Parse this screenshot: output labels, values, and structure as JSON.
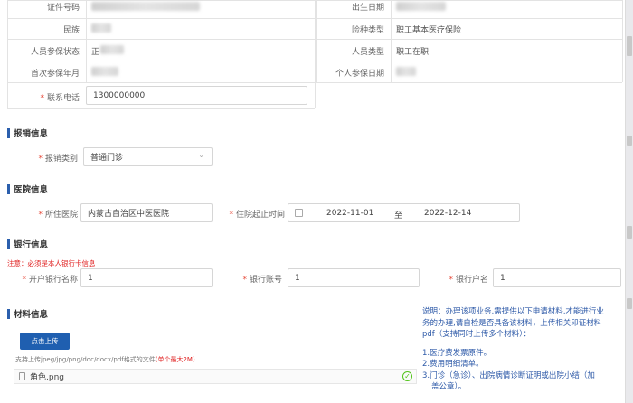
{
  "personal": {
    "id_number_label": "证件号码",
    "birth_date_label": "出生日期",
    "ethnicity_label": "民族",
    "insurance_type_label": "险种类型",
    "insurance_type_value": "职工基本医疗保险",
    "insured_status_label": "人员参保状态",
    "insured_status_value_prefix": "正",
    "person_type_label": "人员类型",
    "person_type_value": "职工在职",
    "first_insured_label": "首次参保年月",
    "personal_insured_date_label": "个人参保日期",
    "phone_label": "联系电话",
    "phone_value": "1300000000"
  },
  "reimbursement": {
    "section_title": "报销信息",
    "category_label": "报销类别",
    "category_value": "普通门诊"
  },
  "medical": {
    "section_title": "医院信息",
    "hospital_label": "所住医院",
    "hospital_value": "内蒙古自治区中医医院",
    "stay_label": "住院起止时间",
    "start_date": "2022-11-01",
    "range_sep": "至",
    "end_date": "2022-12-14"
  },
  "bank": {
    "section_title": "银行信息",
    "note": "注意：必须是本人银行卡信息",
    "bank_name_label": "开户银行名称",
    "bank_name_value": "1",
    "account_label": "银行账号",
    "account_value": "1",
    "holder_label": "银行户名",
    "holder_value": "1"
  },
  "materials": {
    "section_title": "材料信息",
    "upload_button": "点击上传",
    "supported_prefix": "支持上传jpeg/jpg/png/doc/docx/pdf格式的文件",
    "supported_limit": "(单个最大2M)",
    "file_name": "角色.png",
    "help_lines": [
      "说明：办理该项业务,需提供以下申请材料,才能进行业",
      "务的办理,请自检是否具备该材料，上传相关印证材料",
      "pdf（支持同时上传多个材料）：",
      "",
      "1.医疗费发票原件。",
      "2.费用明细清单。",
      "3.门诊（急诊）、出院病情诊断证明或出院小结（加",
      "盖公章）。"
    ]
  },
  "colors": {
    "accent": "#1f5fb0",
    "required": "#e74c3c",
    "note": "#e02020",
    "help": "#2e5aa8",
    "success": "#52c41a"
  }
}
